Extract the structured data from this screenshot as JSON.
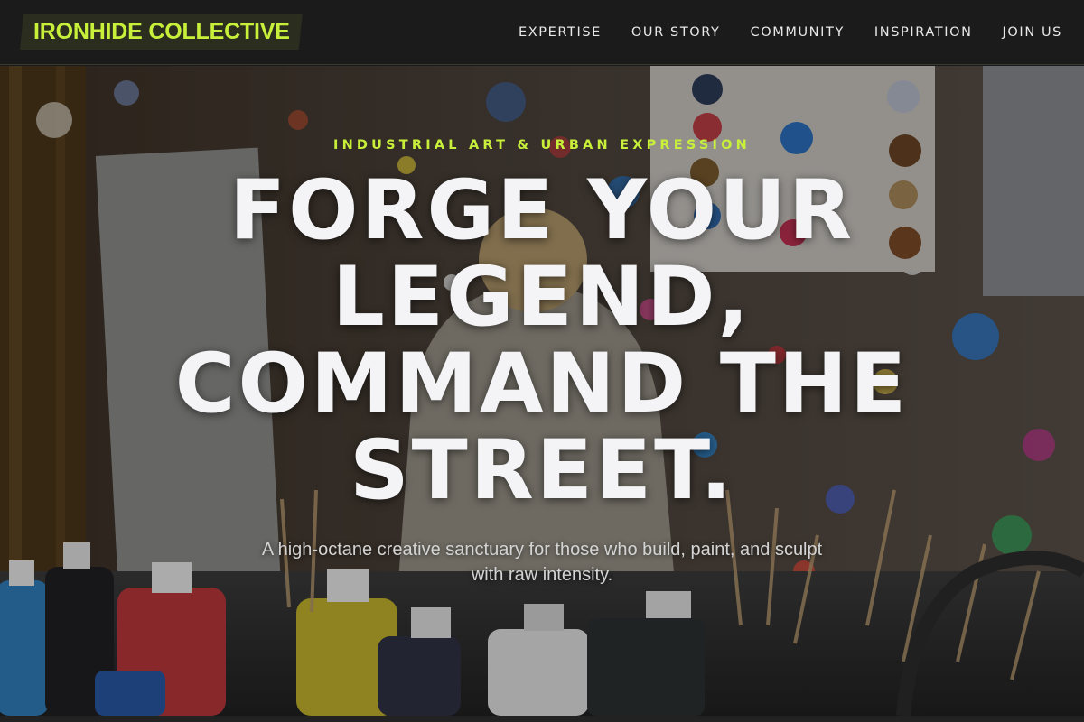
{
  "brand": {
    "name": "IRONHIDE COLLECTIVE"
  },
  "nav": {
    "items": [
      {
        "label": "EXPERTISE"
      },
      {
        "label": "OUR STORY"
      },
      {
        "label": "COMMUNITY"
      },
      {
        "label": "INSPIRATION"
      },
      {
        "label": "JOIN US"
      }
    ]
  },
  "hero": {
    "eyebrow": "INDUSTRIAL ART & URBAN EXPRESSION",
    "headline_lines": [
      "FORGE YOUR",
      "LEGEND,",
      "COMMAND THE",
      "STREET."
    ],
    "subtext": "A high-octane creative sanctuary for those who build, paint, and sculpt with raw intensity.",
    "image_description": "paint-splattered art studio with paint bottles and brushes"
  },
  "colors": {
    "accent": "#c8f03a",
    "nav_background": "#1b1b1b",
    "logo_background": "#2b2d1f",
    "headline_text": "#f4f4f6"
  }
}
